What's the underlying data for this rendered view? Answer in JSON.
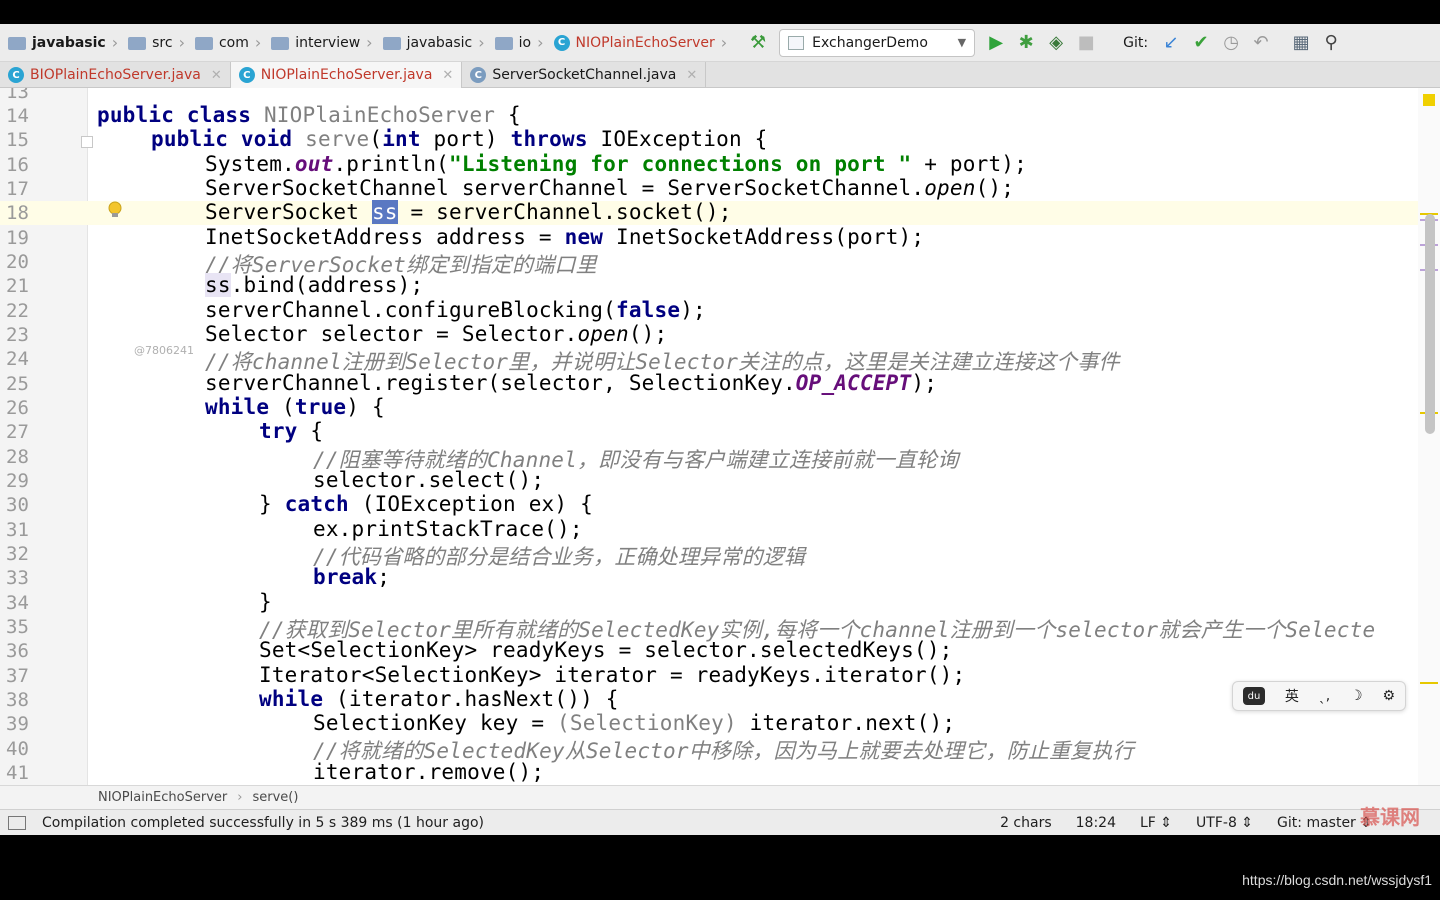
{
  "toolbar": {
    "breadcrumbs": [
      "javabasic",
      "src",
      "com",
      "interview",
      "javabasic",
      "io",
      "NIOPlainEchoServer"
    ],
    "run_config": "ExchangerDemo",
    "git_label": "Git:"
  },
  "tabs": [
    "BIOPlainEchoServer.java",
    "NIOPlainEchoServer.java",
    "ServerSocketChannel.java"
  ],
  "editor": {
    "gutter_watermark": "@7806241",
    "tokens": {
      "public": "public",
      "class": "class",
      "void": "void",
      "int": "int",
      "throws": "throws",
      "new": "new",
      "false": "false",
      "while": "while",
      "true": "true",
      "try": "try",
      "catch": "catch",
      "break": "break"
    },
    "lines": [
      {
        "n": "13"
      },
      {
        "n": "14",
        "name": "NIOPlainEchoServer",
        "rest": "{"
      },
      {
        "n": "15",
        "name": "serve",
        "p1": "(",
        "p2": " port) ",
        "p3": " IOException {"
      },
      {
        "n": "16",
        "p1": "System.",
        "field": "out",
        "p2": ".println(",
        "str": "\"Listening for connections on port \"",
        "p3": " + port);"
      },
      {
        "n": "17",
        "p1": "ServerSocketChannel serverChannel = ServerSocketChannel.",
        "method": "open",
        "p2": "();"
      },
      {
        "n": "18",
        "p1": "ServerSocket ",
        "var": "ss",
        "p2": " = serverChannel.socket();"
      },
      {
        "n": "19",
        "p1": "InetSocketAddress address = ",
        "p2": " InetSocketAddress(port);"
      },
      {
        "n": "20",
        "text": "//将ServerSocket绑定到指定的端口里"
      },
      {
        "n": "21",
        "var": "ss",
        "p1": ".bind(address);"
      },
      {
        "n": "22",
        "p1": "serverChannel.configureBlocking(",
        "p2": ");"
      },
      {
        "n": "23",
        "p1": "Selector selector = Selector.",
        "method": "open",
        "p2": "();"
      },
      {
        "n": "24",
        "text": "//将channel注册到Selector里，并说明让Selector关注的点，这里是关注建立连接这个事件"
      },
      {
        "n": "25",
        "p1": "serverChannel.register(selector, SelectionKey.",
        "field": "OP_ACCEPT",
        "p2": ");"
      },
      {
        "n": "26",
        "p1": " (",
        "p2": ") {"
      },
      {
        "n": "27",
        "p1": " {"
      },
      {
        "n": "28",
        "text": "//阻塞等待就绪的Channel，即没有与客户端建立连接前就一直轮询"
      },
      {
        "n": "29",
        "text": "selector.select();"
      },
      {
        "n": "30",
        "p1": "} ",
        "p2": " (IOException ex) {"
      },
      {
        "n": "31",
        "text": "ex.printStackTrace();"
      },
      {
        "n": "32",
        "text": "//代码省略的部分是结合业务，正确处理异常的逻辑"
      },
      {
        "n": "33",
        "p1": ";"
      },
      {
        "n": "34",
        "text": "}"
      },
      {
        "n": "35",
        "text": "//获取到Selector里所有就绪的SelectedKey实例,每将一个channel注册到一个selector就会产生一个Selecte"
      },
      {
        "n": "36",
        "text": "Set<SelectionKey> readyKeys = selector.selectedKeys();"
      },
      {
        "n": "37",
        "text": "Iterator<SelectionKey> iterator = readyKeys.iterator();"
      },
      {
        "n": "38",
        "p1": " (iterator.hasNext()) {"
      },
      {
        "n": "39",
        "p1": "SelectionKey key = ",
        "cast": "(SelectionKey)",
        "p2": " iterator.next();"
      },
      {
        "n": "40",
        "text": "//将就绪的SelectedKey从Selector中移除，因为马上就要去处理它，防止重复执行"
      },
      {
        "n": "41",
        "text": "iterator.remove();"
      }
    ]
  },
  "ime": {
    "lang": "英"
  },
  "code_breadcrumb": [
    "NIOPlainEchoServer",
    "serve()"
  ],
  "status": {
    "message": "Compilation completed successfully in 5 s 389 ms (1 hour ago)",
    "selection": "2 chars",
    "position": "18:24",
    "line_sep": "LF ⇕",
    "encoding": "UTF-8 ⇕",
    "git": "Git: master ⇕"
  },
  "watermark": {
    "logo": "慕课网",
    "url": "https://blog.csdn.net/wssjdysf1"
  }
}
